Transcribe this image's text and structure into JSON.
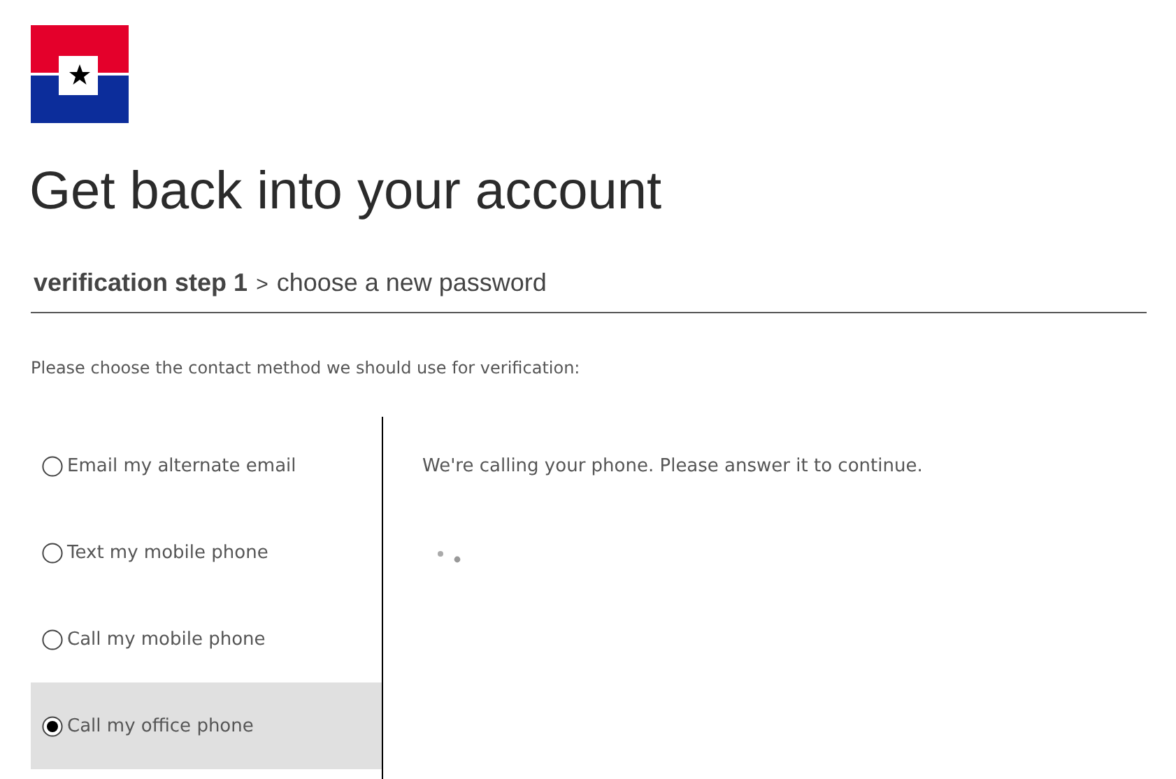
{
  "page": {
    "title": "Get back into your account"
  },
  "breadcrumb": {
    "current": "verification step 1",
    "separator": ">",
    "next": "choose a new password"
  },
  "instruction": "Please choose the contact method we should use for verification:",
  "methods": [
    {
      "label": "Email my alternate email",
      "selected": false
    },
    {
      "label": "Text my mobile phone",
      "selected": false
    },
    {
      "label": "Call my mobile phone",
      "selected": false
    },
    {
      "label": "Call my office phone",
      "selected": true
    }
  ],
  "detail": {
    "message": "We're calling your phone. Please answer it to continue."
  }
}
